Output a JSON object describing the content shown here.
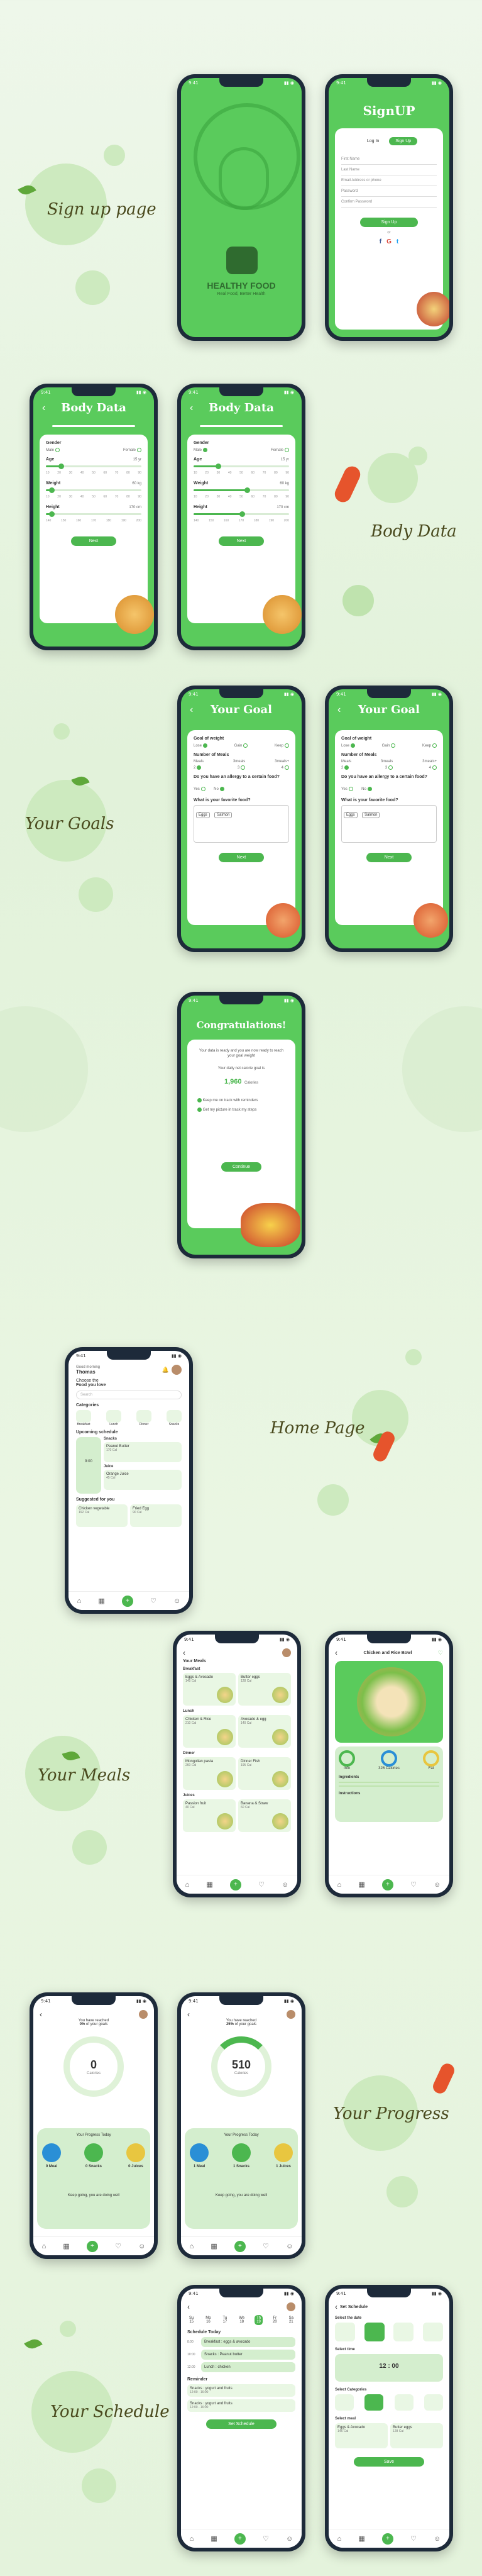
{
  "sections": {
    "signup": "Sign up page",
    "body_data": "Body Data",
    "your_goals": "Your Goals",
    "home_page": "Home Page",
    "your_meals": "Your Meals",
    "your_progress": "Your Progress",
    "your_schedule": "Your Schedule"
  },
  "status": {
    "time": "9:41"
  },
  "splash": {
    "brand": "HEALTHY FOOD",
    "tagline": "Real Food, Better Health"
  },
  "signup": {
    "title": "SignUP",
    "tab_login": "Log In",
    "tab_signup": "Sign Up",
    "fields": [
      "First Name",
      "Last Name",
      "Email Address or phone",
      "Password",
      "Confirm Password"
    ],
    "button": "Sign Up",
    "or": "or",
    "social": [
      "f",
      "G",
      "t"
    ]
  },
  "body": {
    "title": "Body Data",
    "gender": "Gender",
    "male": "Male",
    "female": "Female",
    "age": "Age",
    "age_unit": "15 yr",
    "weight": "Weight",
    "weight_unit": "60 kg",
    "height": "Height",
    "height_unit": "170 cm",
    "next": "Next",
    "age_ticks": [
      "10",
      "20",
      "30",
      "40",
      "50",
      "60",
      "70",
      "80",
      "90"
    ],
    "weight_ticks": [
      "10",
      "20",
      "30",
      "40",
      "50",
      "60",
      "70",
      "80",
      "90"
    ],
    "height_ticks": [
      "140",
      "150",
      "160",
      "170",
      "180",
      "190",
      "200"
    ]
  },
  "goal": {
    "title": "Your Goal",
    "goal_weight": "Goal of weight",
    "options": [
      "Lose",
      "Gain",
      "Keep"
    ],
    "meals": "Number of Meals",
    "meal_options": [
      "Meals",
      "3meals",
      "3meals+"
    ],
    "meal_nums": [
      "2",
      "3",
      "4"
    ],
    "allergy": "Do you have an allergy to a certain food?",
    "yes": "Yes",
    "no": "No",
    "favorite": "What is your favorite food?",
    "chips_a": [
      "Eggs",
      "Salmon"
    ],
    "chips_b": [
      "Eggs",
      "Salmon"
    ],
    "next": "Next"
  },
  "congrats": {
    "title": "Congratulations!",
    "text": "Your data is ready and you are now ready to reach your goal weight",
    "daily": "Your daily net calorie goal is",
    "value": "1,960",
    "unit": "Calories",
    "check1": "Keep me on track with reminders",
    "check2": "Get my picture in track my steps",
    "button": "Continue"
  },
  "home": {
    "greeting": "Good morning",
    "name": "Thomas",
    "choose": "Choose the",
    "choose2": "Food you love",
    "search": "Search",
    "categories_label": "Categories",
    "categories": [
      "Breakfast",
      "Lunch",
      "Dinner",
      "Snacks"
    ],
    "upcoming": "Upcoming schedule",
    "time": "9:00",
    "snacks": "Snacks",
    "snack_item": "Peanut Butter",
    "snack_kcal": "170 Cal",
    "juice": "Juice",
    "juice_item": "Orange Juice",
    "juice_kcal": "45 Cal",
    "suggested": "Suggested for you",
    "sug1": "Chicken vegetable",
    "sug1k": "192 Cal",
    "sug2": "Fried Egg",
    "sug2k": "90 Cal"
  },
  "meals": {
    "title": "Your Meals",
    "groups": [
      "Breakfast",
      "Lunch",
      "Dinner",
      "Juices"
    ],
    "items": [
      [
        "Eggs & Avocado",
        "145 Cal",
        "Butter eggs",
        "128 Cal"
      ],
      [
        "Chicken & Rice",
        "210 Cal",
        "Avocado & egg",
        "140 Cal"
      ],
      [
        "Mongolian pasta",
        "260 Cal",
        "Dinner Fish",
        "195 Cal"
      ],
      [
        "Passion fruit",
        "40 Cal",
        "Banana & Straw",
        "60 Cal"
      ]
    ],
    "detail_title": "Chicken and Rice Bowl",
    "detail_stats": [
      "Info",
      "326 Calories",
      "Fat"
    ],
    "ingredients": "Ingredients",
    "instructions": "Instructions"
  },
  "progress": {
    "reached": "You have reached",
    "of_goals": "of your goals",
    "pct_a": "0%",
    "pct_b": "25%",
    "calorie_a": "0",
    "calorie_b": "510",
    "calorie_unit": "Calories",
    "today": "Your Progress Today",
    "stats_a": [
      "0 Meal",
      "0 Snacks",
      "0 Juices"
    ],
    "stats_b": [
      "1 Meal",
      "1 Snacks",
      "1 Juices"
    ],
    "keep": "Keep going, you are doing well"
  },
  "schedule": {
    "title": "Schedule Today",
    "days": [
      "Su",
      "Mo",
      "Tu",
      "We",
      "Th",
      "Fr",
      "Sa"
    ],
    "dates": [
      "15",
      "16",
      "17",
      "18",
      "19",
      "20",
      "21"
    ],
    "entries": [
      [
        "Breakfast : eggs & avocado",
        "8:00"
      ],
      [
        "Snacks : Peanut butter",
        "10:00"
      ],
      [
        "Lunch : chicken",
        "12:00"
      ]
    ],
    "reminder": "Reminder",
    "rem_items": [
      "Snacks : yogurt and fruits",
      "Snacks : yogurt and fruits"
    ],
    "rem_time": "12:00 - 16:00",
    "set_button": "Set Schedule",
    "set_title": "Set Schedule",
    "select_date": "Select the date",
    "select_time": "Select time",
    "select_cat": "Select Categories",
    "select_meal": "Select meal",
    "time_val": "12 : 00",
    "save": "Save"
  },
  "tabs": [
    "home",
    "calendar",
    "add",
    "heart",
    "user"
  ]
}
